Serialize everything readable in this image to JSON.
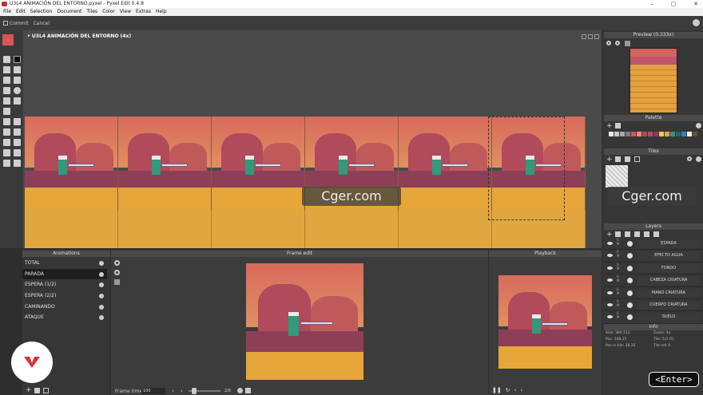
{
  "window": {
    "title": "U3L4 ANIMACIÓN DEL ENTORNO.pyxel - Pyxel Edit 0.4.8",
    "controls": [
      "–",
      "▢",
      "✕"
    ]
  },
  "menu": [
    "File",
    "Edit",
    "Selection",
    "Document",
    "Tiles",
    "Color",
    "View",
    "Extras",
    "Help"
  ],
  "toolbar": {
    "commit": "Commit",
    "cancel": "Cancel"
  },
  "colors": {
    "primary": "#d9545b",
    "secondary": "#ffffff",
    "accent": "#c0302e"
  },
  "document": {
    "title": "• U3L4 ANIMACIÓN DEL ENTORNO   (4x)"
  },
  "preview": {
    "title": "Preview (0.333x)"
  },
  "palette": {
    "title": "Palette",
    "swatches": [
      "#e7e7e7",
      "#c9c9c9",
      "#a9a9a9",
      "#7c7c7c",
      "#d9545b",
      "#e58f6a",
      "#c4444e",
      "#b24d6a",
      "#8a3c5a",
      "#f1c16a",
      "#e8a33a",
      "#2f9b7a",
      "#1f6e57",
      "#3a7bd0",
      "#f3f3c9",
      "#6b4d3a"
    ]
  },
  "tiles": {
    "title": "Tiles"
  },
  "layers": {
    "title": "Layers",
    "items": [
      "ESPADA",
      "EFECTO AGUA",
      "FONDO",
      "CABEZA CRIATURA",
      "MANO CRIATURA",
      "CUERPO CRIATURA",
      "SUELO"
    ]
  },
  "info": {
    "title": "Info",
    "size": "Size: 384,512",
    "zoom": "Zoom: 4x",
    "pos": "Pos: 348,35",
    "tile": "Tile: 5,0 (5)",
    "pos_in_tile": "Pos in tile: 28,35",
    "tile_ref": "Tile ref: X"
  },
  "animations": {
    "title": "Animations",
    "items": [
      "TOTAL",
      "PARADA",
      "ESPERA (1/2)",
      "ESPERA (2/2)",
      "CAMINANDO",
      "ATAQUE"
    ],
    "selected": 1
  },
  "frame_edit": {
    "title": "Frame edit",
    "frame_time_label": "Frame time",
    "frame_time_value": "100",
    "frame_counter": "2/6"
  },
  "playback": {
    "title": "Playback"
  },
  "watermark": {
    "text": "Cger.com"
  },
  "overlay": {
    "enter_label": "<Enter>"
  }
}
